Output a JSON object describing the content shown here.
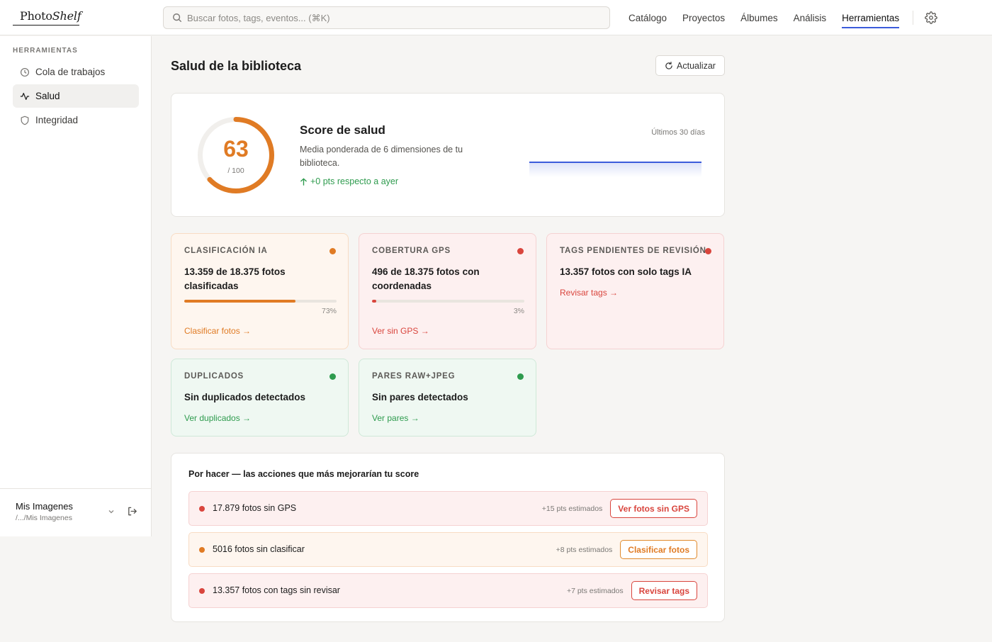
{
  "app": {
    "logo_plain": "Photo",
    "logo_italic": "Shelf"
  },
  "search": {
    "placeholder": "Buscar fotos, tags, eventos... (⌘K)",
    "icon": "search-icon"
  },
  "nav": {
    "items": [
      {
        "label": "Catálogo"
      },
      {
        "label": "Proyectos"
      },
      {
        "label": "Álbumes"
      },
      {
        "label": "Análisis"
      },
      {
        "label": "Herramientas",
        "active": true
      }
    ],
    "settings_icon": "gear-icon"
  },
  "sidebar": {
    "heading": "HERRAMIENTAS",
    "items": [
      {
        "label": "Cola de trabajos",
        "icon": "clock-icon"
      },
      {
        "label": "Salud",
        "icon": "activity-icon",
        "active": true
      },
      {
        "label": "Integridad",
        "icon": "shield-icon"
      }
    ],
    "library": {
      "name": "Mis Imagenes",
      "path": "/.../Mis Imagenes"
    }
  },
  "main": {
    "title": "Salud de la biblioteca",
    "refresh_label": "Actualizar",
    "score": {
      "value": "63",
      "max_label": "/ 100",
      "fraction": 0.63,
      "title": "Score de salud",
      "description": "Media ponderada de 6 dimensiones de tu biblioteca.",
      "delta": "+0 pts respecto a ayer",
      "period": "Últimos 30 días",
      "color": "#e07b24",
      "sparkline_color": "#3b5bdb"
    },
    "metrics": [
      {
        "label": "CLASIFICACIÓN IA",
        "value": "13.359 de 18.375 fotos clasificadas",
        "percent": 73,
        "percent_label": "73%",
        "link": "Clasificar fotos →",
        "status": "warn",
        "color": "#e07b24"
      },
      {
        "label": "COBERTURA GPS",
        "value": "496 de 18.375 fotos con coordenadas",
        "percent": 3,
        "percent_label": "3%",
        "link": "Ver sin GPS →",
        "status": "bad",
        "color": "#d9453d"
      },
      {
        "label": "TAGS PENDIENTES DE REVISIÓN",
        "value": "13.357 fotos con solo tags IA",
        "link": "Revisar tags →",
        "status": "bad",
        "color": "#d9453d"
      },
      {
        "label": "DUPLICADOS",
        "value": "Sin duplicados detectados",
        "link": "Ver duplicados →",
        "status": "good",
        "color": "#2e9b4e"
      },
      {
        "label": "PARES RAW+JPEG",
        "value": "Sin pares detectados",
        "link": "Ver pares →",
        "status": "good",
        "color": "#2e9b4e"
      }
    ],
    "todo": {
      "title": "Por hacer — las acciones que más mejorarían tu score",
      "items": [
        {
          "text": "17.879 fotos sin GPS",
          "estimate": "+15 pts estimados",
          "button": "Ver fotos sin GPS",
          "status": "bad"
        },
        {
          "text": "5016 fotos sin clasificar",
          "estimate": "+8 pts estimados",
          "button": "Clasificar fotos",
          "status": "warn"
        },
        {
          "text": "13.357 fotos con tags sin revisar",
          "estimate": "+7 pts estimados",
          "button": "Revisar tags",
          "status": "bad"
        }
      ]
    }
  }
}
